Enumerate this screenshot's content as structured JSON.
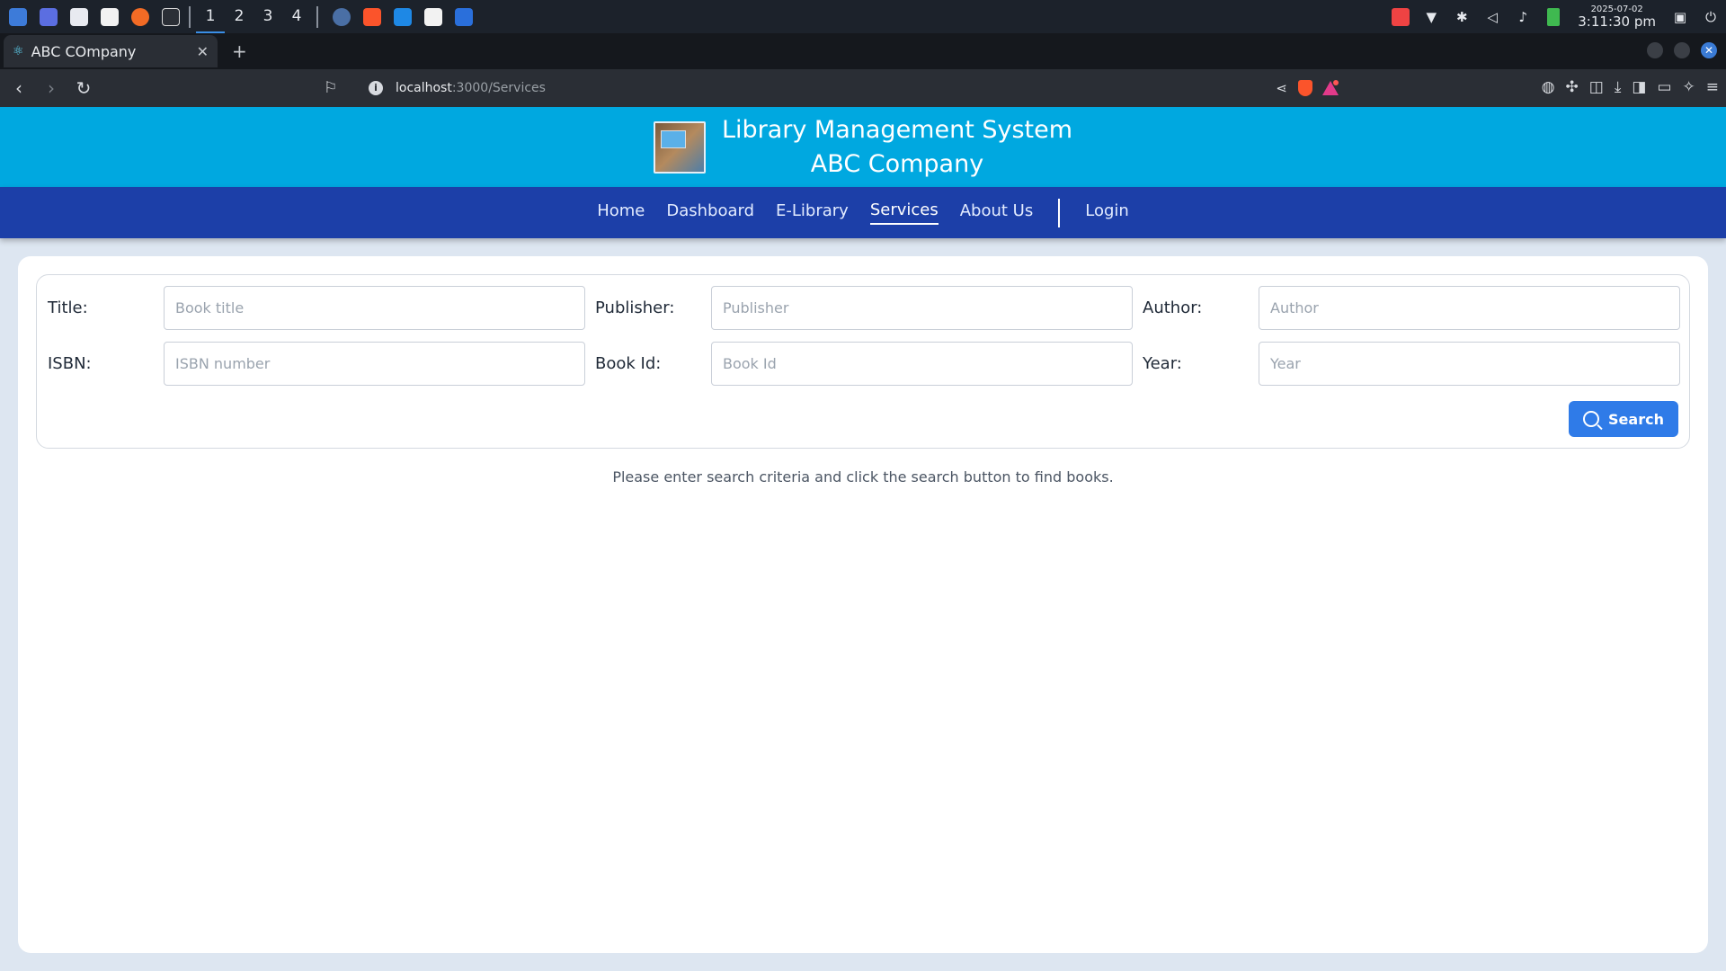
{
  "taskbar": {
    "workspaces": [
      "1",
      "2",
      "3",
      "4"
    ],
    "active_workspace": "1",
    "clock_date": "2025-07-02",
    "clock_time": "3:11:30 pm"
  },
  "browser": {
    "tab_title": "ABC COmpany",
    "url_host": "localhost",
    "url_path": ":3000/Services"
  },
  "header": {
    "title_line1": "Library Management System",
    "title_line2": "ABC Company"
  },
  "nav": {
    "items": [
      "Home",
      "Dashboard",
      "E-Library",
      "Services",
      "About Us"
    ],
    "active": "Services",
    "login": "Login"
  },
  "search": {
    "title_label": "Title:",
    "title_placeholder": "Book title",
    "publisher_label": "Publisher:",
    "publisher_placeholder": "Publisher",
    "author_label": "Author:",
    "author_placeholder": "Author",
    "isbn_label": "ISBN:",
    "isbn_placeholder": "ISBN number",
    "bookid_label": "Book Id:",
    "bookid_placeholder": "Book Id",
    "year_label": "Year:",
    "year_placeholder": "Year",
    "button_label": "Search"
  },
  "hint": "Please enter search criteria and click the search button to find books.",
  "colors": {
    "header_bg": "#00a8e0",
    "nav_bg": "#1c3fa8",
    "button_bg": "#2f7be8"
  }
}
